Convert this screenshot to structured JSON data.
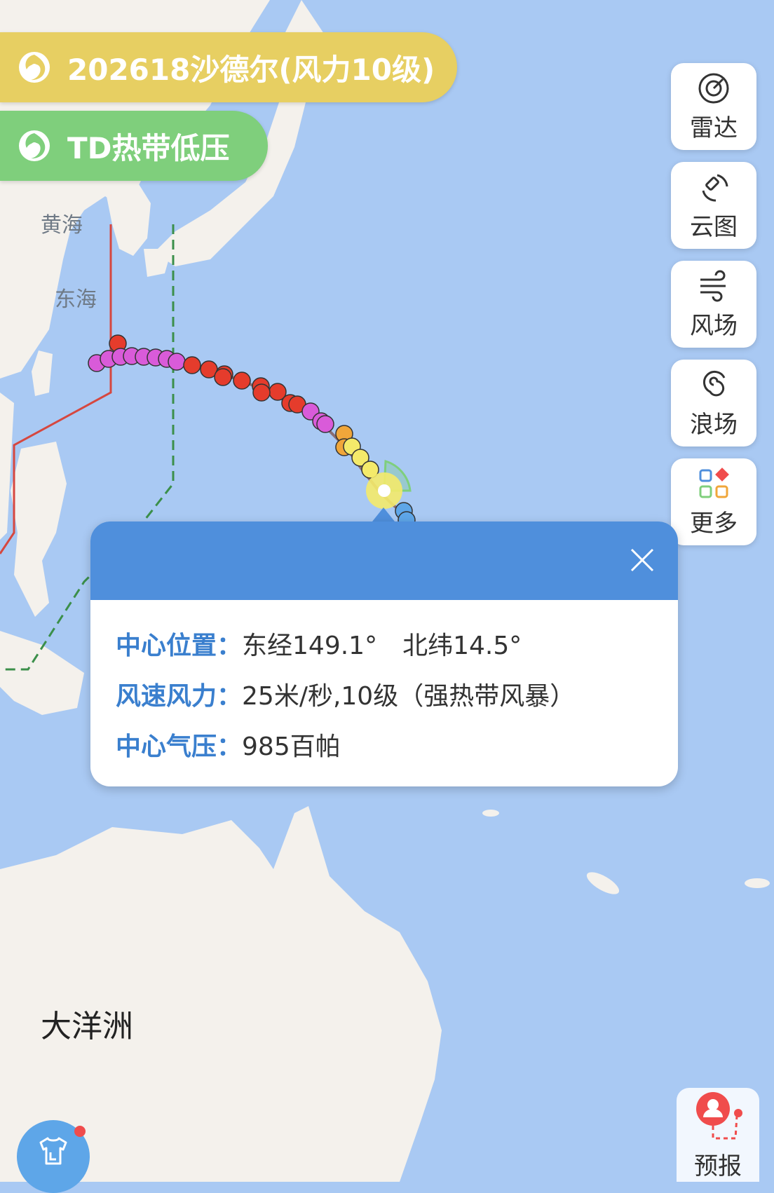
{
  "typhoon_pills": [
    {
      "label": "202618沙德尔(风力10级)",
      "color": "#e7cf62"
    },
    {
      "label": "TD热带低压",
      "color": "#7fcf7c"
    }
  ],
  "map_labels": {
    "yellow_sea": "黄海",
    "east_sea": "东海",
    "oceania": "大洋洲"
  },
  "side_buttons": {
    "radar": "雷达",
    "cloud": "云图",
    "wind": "风场",
    "wave": "浪场",
    "more": "更多"
  },
  "popup": {
    "title": "",
    "rows": [
      {
        "label": "中心位置：",
        "value": "东经149.1°　北纬14.5°"
      },
      {
        "label": "风速风力：",
        "value": "25米/秒,10级（强热带风暴）"
      },
      {
        "label": "中心气压：",
        "value": "985百帕"
      }
    ]
  },
  "forecast_label": "预报",
  "colors": {
    "ocean": "#a9c9f3",
    "land": "#f4f1ec",
    "track_pink": "#d95bd9",
    "track_red": "#e53c2c",
    "track_orange": "#f0a63a",
    "track_yellow": "#f4ea6a",
    "track_blue": "#5ea6e8",
    "accent": "#4f8fdc"
  }
}
